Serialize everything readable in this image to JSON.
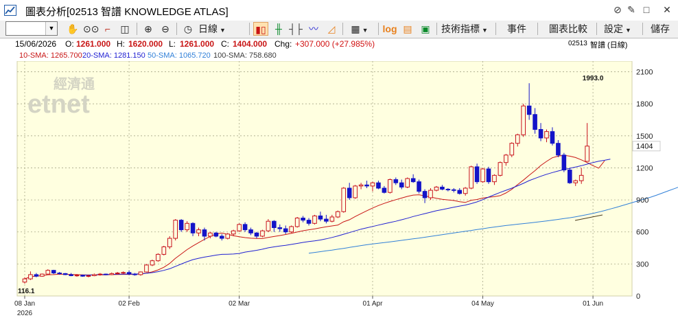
{
  "window": {
    "title": "圖表分析[02513 智譜 KNOWLEDGE ATLAS]",
    "controls": [
      "⊘",
      "✎",
      "□",
      "✕"
    ]
  },
  "toolbar": {
    "symbol_value": "",
    "period_label": "日線",
    "log_label": "log",
    "indicators_label": "技術指標",
    "events_label": "事件",
    "compare_label": "圖表比較",
    "settings_label": "設定",
    "save_label": "儲存"
  },
  "info": {
    "date": "15/06/2026",
    "open_label": "O:",
    "open": "1261.000",
    "high_label": "H:",
    "high": "1620.000",
    "low_label": "L:",
    "low": "1261.000",
    "close_label": "C:",
    "close": "1404.000",
    "chg_label": "Chg:",
    "chg": "+307.000 (+27.985%)",
    "code": "02513",
    "name_period": "智譜 (日線)"
  },
  "sma": {
    "sma10": "10-SMA: 1265.700",
    "sma20": "20-SMA: 1281.150",
    "sma50": "50-SMA: 1065.720",
    "sma100": "100-SMA: 758.680"
  },
  "watermark": {
    "cn": "經濟通",
    "en": "etnet"
  },
  "colors": {
    "bg": "#ffffe0",
    "up": "#c8101c",
    "down": "#1414c8",
    "sma10": "#c81414",
    "sma20": "#1e1ed2",
    "sma50": "#2f7fd8",
    "sma100": "#3a3a3a",
    "chg": "#d01010"
  },
  "chart_data": {
    "type": "candlestick",
    "ylim": [
      0,
      2200
    ],
    "yticks": [
      0,
      300,
      600,
      900,
      1200,
      1500,
      1800,
      2100
    ],
    "xticks": [
      {
        "label": "08 Jan",
        "i": 0
      },
      {
        "label": "02 Feb",
        "i": 18
      },
      {
        "label": "02 Mar",
        "i": 37
      },
      {
        "label": "01 Apr",
        "i": 60
      },
      {
        "label": "04 May",
        "i": 79
      },
      {
        "label": "01 Jun",
        "i": 98
      }
    ],
    "year_label": "2026",
    "last_price_label": "1404",
    "high_marker": {
      "label": "1993.0",
      "i": 98,
      "value": 1993
    },
    "low_marker": {
      "label": "116.1",
      "i": 0,
      "value": 116.1
    },
    "candles": [
      [
        130,
        175,
        116.1,
        160
      ],
      [
        160,
        230,
        150,
        200
      ],
      [
        200,
        215,
        175,
        185
      ],
      [
        185,
        210,
        180,
        205
      ],
      [
        205,
        250,
        200,
        240
      ],
      [
        240,
        245,
        205,
        215
      ],
      [
        215,
        225,
        200,
        210
      ],
      [
        210,
        215,
        195,
        200
      ],
      [
        200,
        215,
        185,
        190
      ],
      [
        190,
        205,
        180,
        195
      ],
      [
        195,
        200,
        180,
        185
      ],
      [
        185,
        200,
        175,
        190
      ],
      [
        190,
        210,
        185,
        200
      ],
      [
        200,
        215,
        190,
        205
      ],
      [
        205,
        210,
        195,
        200
      ],
      [
        200,
        220,
        195,
        210
      ],
      [
        210,
        225,
        200,
        215
      ],
      [
        215,
        230,
        205,
        220
      ],
      [
        220,
        240,
        195,
        205
      ],
      [
        205,
        215,
        190,
        200
      ],
      [
        200,
        230,
        190,
        225
      ],
      [
        225,
        300,
        220,
        290
      ],
      [
        290,
        340,
        280,
        330
      ],
      [
        330,
        400,
        320,
        390
      ],
      [
        390,
        470,
        380,
        460
      ],
      [
        460,
        560,
        440,
        540
      ],
      [
        540,
        720,
        520,
        710
      ],
      [
        710,
        720,
        600,
        620
      ],
      [
        620,
        700,
        600,
        680
      ],
      [
        680,
        690,
        560,
        590
      ],
      [
        590,
        640,
        560,
        620
      ],
      [
        620,
        640,
        520,
        560
      ],
      [
        560,
        600,
        540,
        590
      ],
      [
        590,
        600,
        550,
        560
      ],
      [
        560,
        580,
        520,
        540
      ],
      [
        540,
        590,
        530,
        580
      ],
      [
        580,
        620,
        560,
        610
      ],
      [
        610,
        680,
        600,
        670
      ],
      [
        670,
        690,
        600,
        620
      ],
      [
        620,
        640,
        570,
        590
      ],
      [
        590,
        600,
        540,
        560
      ],
      [
        560,
        620,
        550,
        610
      ],
      [
        610,
        720,
        600,
        700
      ],
      [
        700,
        710,
        600,
        640
      ],
      [
        640,
        670,
        600,
        630
      ],
      [
        630,
        660,
        580,
        600
      ],
      [
        600,
        660,
        590,
        650
      ],
      [
        650,
        740,
        640,
        730
      ],
      [
        730,
        750,
        690,
        710
      ],
      [
        710,
        730,
        660,
        680
      ],
      [
        680,
        760,
        670,
        750
      ],
      [
        750,
        790,
        700,
        720
      ],
      [
        720,
        760,
        680,
        700
      ],
      [
        700,
        760,
        690,
        740
      ],
      [
        740,
        800,
        730,
        790
      ],
      [
        790,
        1020,
        780,
        1010
      ],
      [
        1010,
        1060,
        900,
        920
      ],
      [
        920,
        1040,
        910,
        1030
      ],
      [
        1030,
        1060,
        1000,
        1040
      ],
      [
        1040,
        1080,
        1010,
        1030
      ],
      [
        1030,
        1070,
        980,
        1060
      ],
      [
        1060,
        1080,
        1000,
        1010
      ],
      [
        1010,
        1030,
        960,
        970
      ],
      [
        970,
        1100,
        960,
        1090
      ],
      [
        1090,
        1110,
        1040,
        1060
      ],
      [
        1060,
        1090,
        1000,
        1020
      ],
      [
        1020,
        1110,
        1010,
        1100
      ],
      [
        1100,
        1140,
        1060,
        1070
      ],
      [
        1070,
        1090,
        960,
        980
      ],
      [
        980,
        1000,
        870,
        920
      ],
      [
        920,
        1010,
        900,
        990
      ],
      [
        990,
        1030,
        980,
        1020
      ],
      [
        1020,
        1040,
        990,
        1000
      ],
      [
        1000,
        1010,
        980,
        995
      ],
      [
        995,
        1010,
        970,
        990
      ],
      [
        990,
        1010,
        950,
        960
      ],
      [
        960,
        1020,
        940,
        1010
      ],
      [
        1010,
        1220,
        1000,
        1210
      ],
      [
        1210,
        1240,
        1050,
        1070
      ],
      [
        1070,
        1200,
        1060,
        1190
      ],
      [
        1190,
        1210,
        1050,
        1070
      ],
      [
        1070,
        1140,
        1040,
        1130
      ],
      [
        1130,
        1260,
        1120,
        1250
      ],
      [
        1250,
        1330,
        1220,
        1320
      ],
      [
        1320,
        1440,
        1300,
        1430
      ],
      [
        1430,
        1520,
        1400,
        1510
      ],
      [
        1510,
        1800,
        1490,
        1780
      ],
      [
        1780,
        1993,
        1650,
        1700
      ],
      [
        1700,
        1760,
        1520,
        1560
      ],
      [
        1560,
        1620,
        1450,
        1480
      ],
      [
        1480,
        1560,
        1440,
        1540
      ],
      [
        1540,
        1580,
        1410,
        1430
      ],
      [
        1430,
        1460,
        1300,
        1320
      ],
      [
        1320,
        1340,
        1160,
        1180
      ],
      [
        1180,
        1200,
        1050,
        1060
      ],
      [
        1060,
        1090,
        1030,
        1080
      ],
      [
        1080,
        1200,
        1050,
        1130
      ],
      [
        1261,
        1620,
        1261,
        1404
      ]
    ],
    "sma_lines": {
      "sma10": {
        "start": 0,
        "values": [
          160,
          180,
          186,
          190,
          199,
          200,
          204,
          203,
          202,
          200,
          198,
          197,
          197,
          198,
          198,
          200,
          201,
          202,
          202,
          203,
          205,
          213,
          226,
          244,
          269,
          304,
          353,
          393,
          434,
          468,
          500,
          530,
          558,
          581,
          589,
          577,
          565,
          555,
          547,
          541,
          539,
          538,
          548,
          557,
          566,
          576,
          587,
          599,
          611,
          620,
          628,
          639,
          648,
          656,
          664,
          695,
          714,
          744,
          771,
          798,
          824,
          847,
          867,
          885,
          902,
          917,
          933,
          945,
          948,
          937,
          926,
          915,
          906,
          900,
          894,
          883,
          876,
          897,
          904,
          917,
          925,
          930,
          940,
          965,
          999,
          1043,
          1085,
          1131,
          1174,
          1222,
          1261,
          1295,
          1310,
          1318,
          1310,
          1297,
          1275,
          1250,
          1221,
          1197,
          1265.7
        ]
      },
      "sma20": {
        "start": 10,
        "values": [
          195,
          196,
          198,
          200,
          201,
          202,
          203,
          204,
          205,
          206,
          208,
          212,
          219,
          228,
          240,
          255,
          277,
          299,
          321,
          340,
          353,
          364,
          373,
          383,
          390,
          391,
          393,
          398,
          411,
          419,
          428,
          438,
          451,
          460,
          468,
          475,
          483,
          492,
          502,
          510,
          516,
          524,
          535,
          548,
          562,
          578,
          594,
          610,
          626,
          638,
          651,
          664,
          676,
          688,
          700,
          714,
          728,
          744,
          758,
          771,
          785,
          798,
          809,
          820,
          831,
          842,
          852,
          865,
          881,
          902,
          926,
          948,
          970,
          990,
          1010,
          1032,
          1055,
          1081,
          1101,
          1121,
          1140,
          1156,
          1171,
          1184,
          1196,
          1208,
          1220,
          1235,
          1250,
          1262,
          1271,
          1281.15
        ]
      },
      "sma50": {
        "start": 49,
        "values": [
          400,
          408,
          415,
          423,
          430,
          438,
          446,
          455,
          463,
          472,
          480,
          487,
          494,
          500,
          507,
          514,
          521,
          528,
          535,
          542,
          550,
          558,
          566,
          574,
          582,
          590,
          598,
          606,
          614,
          622,
          630,
          638,
          646,
          653,
          660,
          666,
          672,
          678,
          684,
          690,
          696,
          703,
          710,
          717,
          725,
          733,
          742,
          752,
          762,
          774,
          786,
          800,
          815,
          830,
          846,
          862,
          878,
          894,
          910,
          926,
          945,
          965,
          985,
          1005,
          1025,
          1045,
          1060,
          1065.72
        ]
      }
    }
  }
}
